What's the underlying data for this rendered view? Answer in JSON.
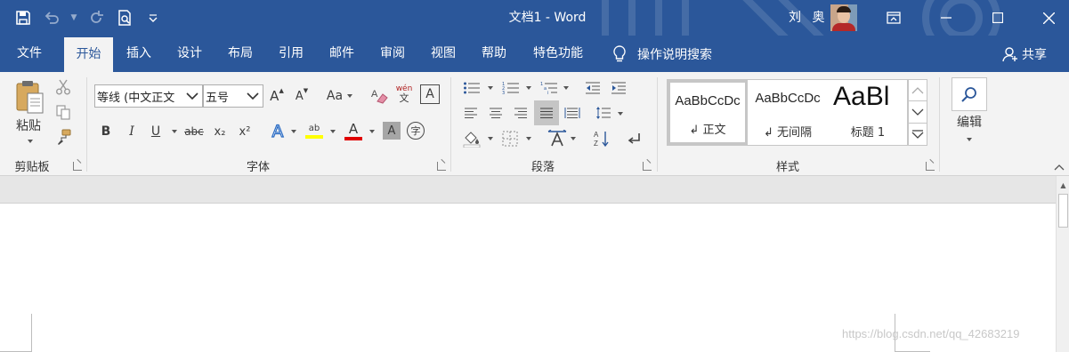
{
  "title_bar": {
    "doc_title": "文档1 - Word",
    "user_name": "刘 奥"
  },
  "tabs": [
    "文件",
    "开始",
    "插入",
    "设计",
    "布局",
    "引用",
    "邮件",
    "审阅",
    "视图",
    "帮助",
    "特色功能"
  ],
  "active_tab": "开始",
  "tell_me": "操作说明搜索",
  "share": "共享",
  "ribbon": {
    "clipboard": {
      "paste_label": "粘贴",
      "group_label": "剪贴板"
    },
    "font": {
      "font_name": "等线 (中文正文",
      "font_size": "五号",
      "case_label": "Aa",
      "pinyin_top": "wén",
      "pinyin_bottom": "文",
      "border_char": "A",
      "bold": "B",
      "italic": "I",
      "underline": "U",
      "strike": "abc",
      "subscript": "x₂",
      "superscript": "x²",
      "effects": "A",
      "highlight": "ab",
      "font_color": "A",
      "shading": "A",
      "enclose": "字",
      "grow": "A",
      "shrink": "A",
      "group_label": "字体"
    },
    "paragraph": {
      "group_label": "段落"
    },
    "styles": {
      "items": [
        {
          "preview": "AaBbCcDc",
          "name": "↲ 正文"
        },
        {
          "preview": "AaBbCcDc",
          "name": "↲ 无间隔"
        },
        {
          "preview": "AaBl",
          "name": "标题 1"
        }
      ],
      "group_label": "样式"
    },
    "editing": {
      "label": "编辑"
    }
  },
  "watermark": "https://blog.csdn.net/qq_42683219",
  "colors": {
    "word_blue": "#2b579a",
    "ribbon_bg": "#f3f3f3",
    "highlight_yellow": "#ffff00",
    "font_red": "#e00000"
  }
}
